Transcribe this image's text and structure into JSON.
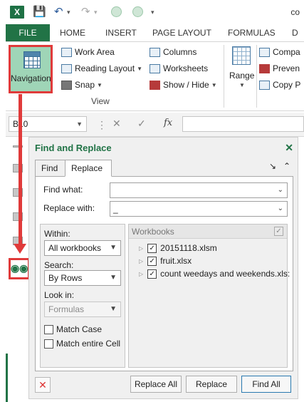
{
  "app": {
    "title_fragment": "co",
    "qat": {
      "app_icon": "excel-icon",
      "save_icon": "save-icon",
      "undo_icon": "undo-icon",
      "redo_icon": "redo-icon"
    }
  },
  "ribbon_tabs": [
    "FILE",
    "HOME",
    "INSERT",
    "PAGE LAYOUT",
    "FORMULAS",
    "D"
  ],
  "ribbon": {
    "navigation_label": "Navigation",
    "view_items": [
      {
        "label": "Work Area",
        "icon": "work-area-icon"
      },
      {
        "label": "Reading Layout",
        "icon": "reading-layout-icon"
      },
      {
        "label": "Snap",
        "icon": "camera-icon"
      },
      {
        "label": "Columns",
        "icon": "columns-icon"
      },
      {
        "label": "Worksheets",
        "icon": "worksheets-icon"
      },
      {
        "label": "Show / Hide",
        "icon": "show-hide-icon"
      }
    ],
    "view_group_label": "View",
    "range_label": "Range",
    "right_items": [
      "Compa",
      "Preven",
      "Copy P"
    ]
  },
  "formula_bar": {
    "name_box": "B10",
    "cancel": "✕",
    "enter": "✓",
    "fx": "fx"
  },
  "find_replace": {
    "title": "Find and Replace",
    "tabs": [
      "Find",
      "Replace"
    ],
    "find_what_label": "Find what:",
    "find_what_value": "",
    "replace_with_label": "Replace with:",
    "replace_with_value": "_",
    "within_label": "Within:",
    "within_value": "All workbooks",
    "search_label": "Search:",
    "search_value": "By Rows",
    "lookin_label": "Look in:",
    "lookin_value": "Formulas",
    "match_case": "Match Case",
    "match_entire_cell": "Match entire Cell",
    "workbooks_header": "Workbooks",
    "workbooks": [
      "20151118.xlsm",
      "fruit.xlsx",
      "count weedays and weekends.xls:"
    ],
    "buttons": {
      "replace_all": "Replace All",
      "replace": "Replace",
      "find_all": "Find All"
    }
  },
  "colors": {
    "excel_green": "#217346",
    "highlight_red": "#e03a3a",
    "nav_selected": "#9fd5b7"
  }
}
